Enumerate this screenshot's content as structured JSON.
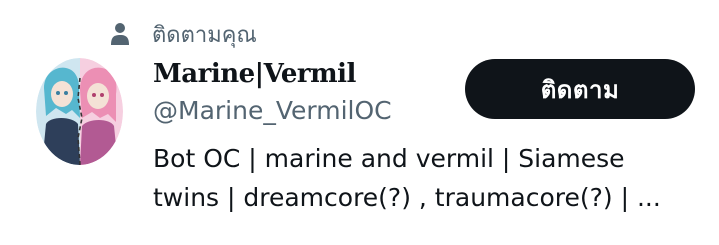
{
  "social_context": {
    "icon": "person-icon",
    "label": "ติดตามคุณ"
  },
  "user": {
    "display_name": "Marine|Vermil",
    "handle": "@Marine_VermilOC",
    "bio_lines": [
      "Bot OC | marine and vermil | Siamese",
      "twins | dreamcore(?) , traumacore(?) | ..."
    ]
  },
  "follow_button": {
    "label": "ติดตาม"
  },
  "colors": {
    "button_bg": "#0f1419",
    "secondary_text": "#536471",
    "icon": "#536471"
  }
}
